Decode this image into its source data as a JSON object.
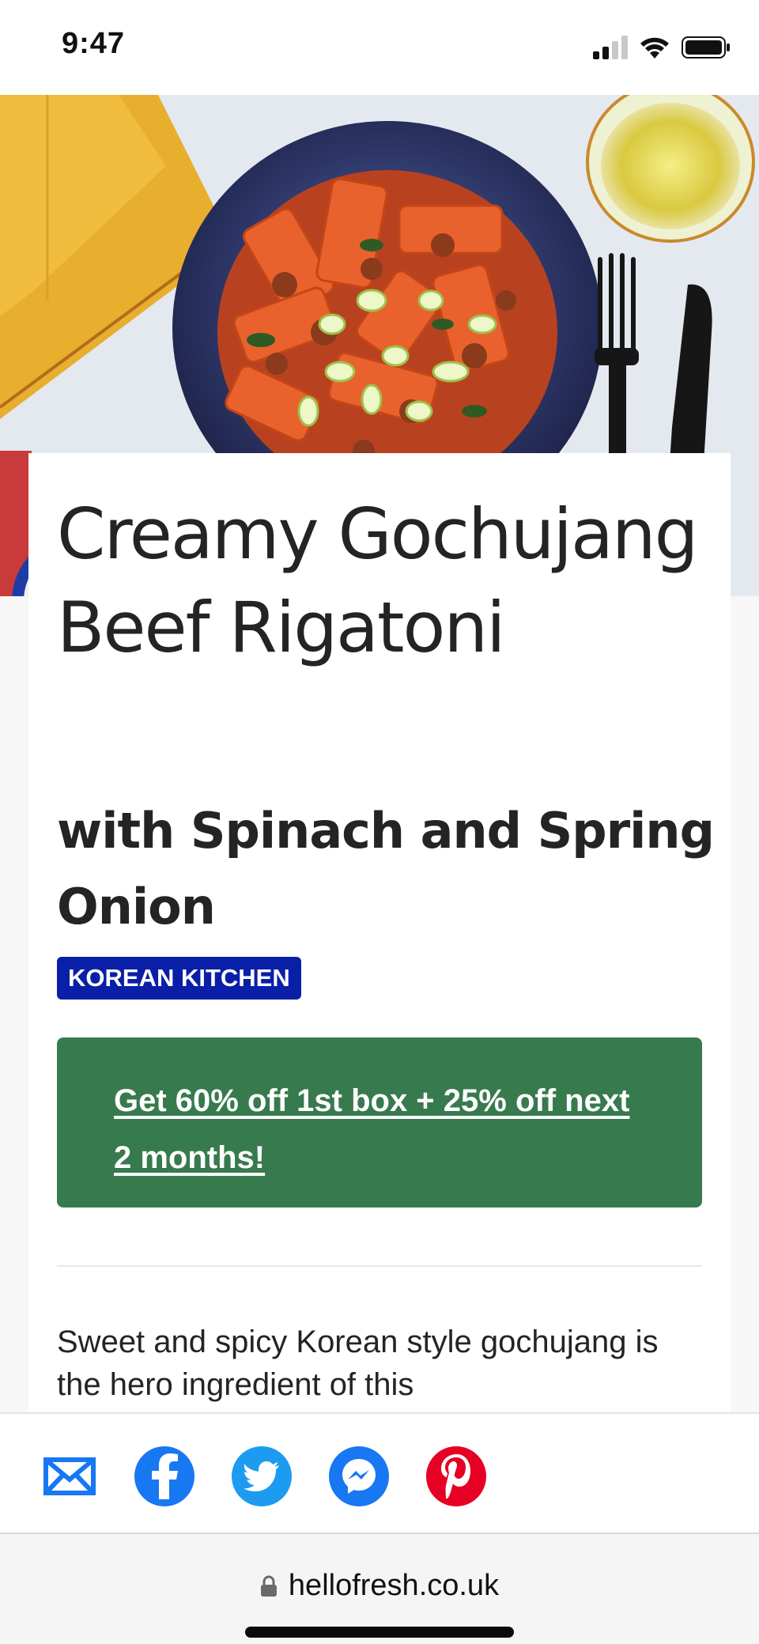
{
  "status_bar": {
    "time": "9:47"
  },
  "recipe": {
    "title": "Creamy Gochujang Beef Rigatoni",
    "subtitle": "with Spinach and Spring Onion",
    "tag": "KOREAN KITCHEN",
    "promo_label": "Get 60% off 1st box + 25% off next 2 months!",
    "description": "Sweet and spicy Korean style gochujang is the hero ingredient of this"
  },
  "share": {
    "buttons": [
      {
        "icon": "email-icon"
      },
      {
        "icon": "facebook-icon"
      },
      {
        "icon": "twitter-icon"
      },
      {
        "icon": "messenger-icon"
      },
      {
        "icon": "pinterest-icon"
      }
    ]
  },
  "browser": {
    "url": "hellofresh.co.uk"
  },
  "colors": {
    "tag_bg": "#0a1fa8",
    "promo_bg": "#377a4e",
    "facebook": "#1877f2",
    "twitter": "#1d9bf0",
    "messenger": "#1877f2",
    "pinterest": "#e60023",
    "email": "#1877f2"
  }
}
